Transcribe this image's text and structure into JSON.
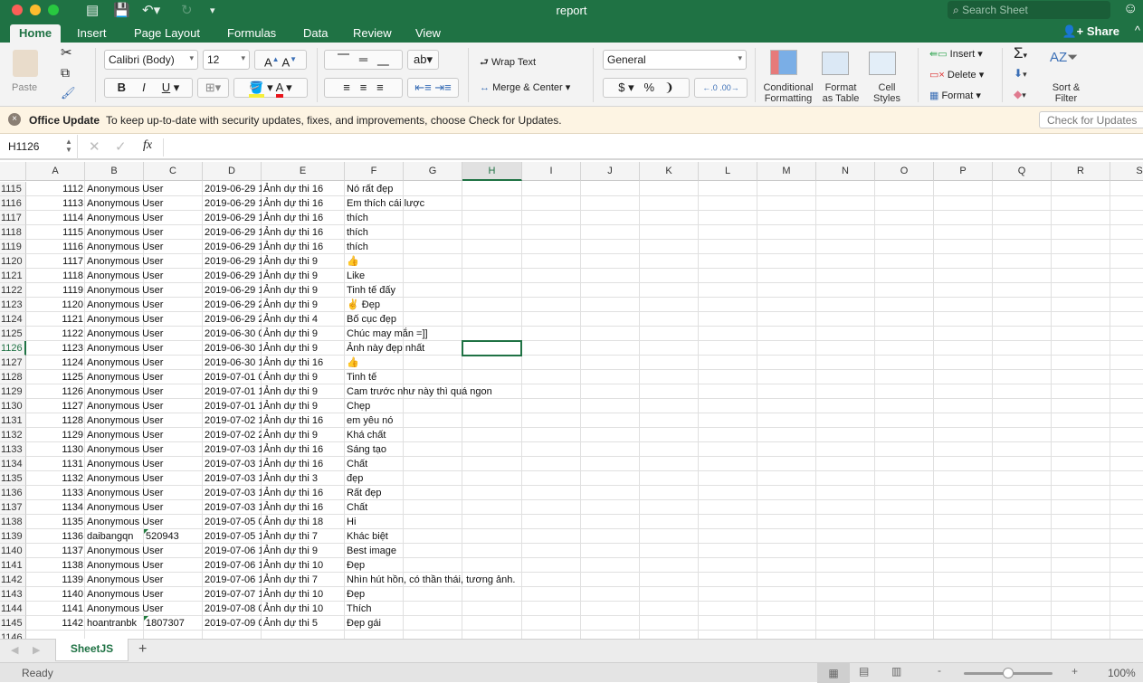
{
  "window": {
    "title": "report",
    "search_placeholder": "Search Sheet",
    "share": "Share"
  },
  "tabs": [
    "Home",
    "Insert",
    "Page Layout",
    "Formulas",
    "Data",
    "Review",
    "View"
  ],
  "ribbon": {
    "paste": "Paste",
    "font_name": "Calibri (Body)",
    "font_size": "12",
    "bold": "B",
    "italic": "I",
    "underline": "U",
    "wrap_text": "Wrap Text",
    "merge_center": "Merge & Center",
    "number_format": "General",
    "currency": "$",
    "percent": "%",
    "comma": "❩",
    "conditional_formatting": [
      "Conditional",
      "Formatting"
    ],
    "format_as_table": [
      "Format",
      "as Table"
    ],
    "cell_styles": [
      "Cell",
      "Styles"
    ],
    "insert": "Insert",
    "delete": "Delete",
    "format": "Format",
    "sort_filter": [
      "Sort &",
      "Filter"
    ],
    "fill_color": "#f5ef3a",
    "font_color": "#e8141b"
  },
  "update_bar": {
    "title": "Office Update",
    "message": "To keep up-to-date with security updates, fixes, and improvements, choose Check for Updates.",
    "button": "Check for Updates"
  },
  "formula_bar": {
    "name_box": "H1126",
    "formula": ""
  },
  "grid": {
    "columns": [
      "A",
      "B",
      "C",
      "D",
      "E",
      "F",
      "G",
      "H",
      "I",
      "J",
      "K",
      "L",
      "M",
      "N",
      "O",
      "P",
      "Q",
      "R",
      "S"
    ],
    "selected_column": "H",
    "selected_row": "1126",
    "rows": [
      [
        "1115",
        "1112",
        "Anonymous User",
        "",
        "2019-06-29 1",
        "Ảnh dự thi 16",
        "Nó rất đẹp"
      ],
      [
        "1116",
        "1113",
        "Anonymous User",
        "",
        "2019-06-29 1",
        "Ảnh dự thi 16",
        "Em thích cái lược"
      ],
      [
        "1117",
        "1114",
        "Anonymous User",
        "",
        "2019-06-29 1",
        "Ảnh dự thi 16",
        "thích"
      ],
      [
        "1118",
        "1115",
        "Anonymous User",
        "",
        "2019-06-29 1",
        "Ảnh dự thi 16",
        "thích"
      ],
      [
        "1119",
        "1116",
        "Anonymous User",
        "",
        "2019-06-29 1",
        "Ảnh dự thi 16",
        "thích"
      ],
      [
        "1120",
        "1117",
        "Anonymous User",
        "",
        "2019-06-29 1",
        "Ảnh dự thi 9",
        "👍"
      ],
      [
        "1121",
        "1118",
        "Anonymous User",
        "",
        "2019-06-29 1",
        "Ảnh dự thi 9",
        "Like"
      ],
      [
        "1122",
        "1119",
        "Anonymous User",
        "",
        "2019-06-29 1",
        "Ảnh dự thi 9",
        "Tinh tế đấy"
      ],
      [
        "1123",
        "1120",
        "Anonymous User",
        "",
        "2019-06-29 2",
        "Ảnh dự thi 9",
        "✌️ Đẹp"
      ],
      [
        "1124",
        "1121",
        "Anonymous User",
        "",
        "2019-06-29 2",
        "Ảnh dự thi 4",
        "Bố cục đẹp"
      ],
      [
        "1125",
        "1122",
        "Anonymous User",
        "",
        "2019-06-30 0",
        "Ảnh dự thi 9",
        "Chúc may mắn =]]"
      ],
      [
        "1126",
        "1123",
        "Anonymous User",
        "",
        "2019-06-30 1",
        "Ảnh dự thi 9",
        "Ảnh này đẹp nhất"
      ],
      [
        "1127",
        "1124",
        "Anonymous User",
        "",
        "2019-06-30 1",
        "Ảnh dự thi 16",
        "👍"
      ],
      [
        "1128",
        "1125",
        "Anonymous User",
        "",
        "2019-07-01 0",
        "Ảnh dự thi 9",
        "Tinh tế"
      ],
      [
        "1129",
        "1126",
        "Anonymous User",
        "",
        "2019-07-01 1",
        "Ảnh dự thi 9",
        "Cam trước như này thì quá ngon"
      ],
      [
        "1130",
        "1127",
        "Anonymous User",
        "",
        "2019-07-01 1",
        "Ảnh dự thi 9",
        "Chẹp"
      ],
      [
        "1131",
        "1128",
        "Anonymous User",
        "",
        "2019-07-02 1",
        "Ảnh dự thi 16",
        "em yêu nó"
      ],
      [
        "1132",
        "1129",
        "Anonymous User",
        "",
        "2019-07-02 2",
        "Ảnh dự thi 9",
        "Khá chất"
      ],
      [
        "1133",
        "1130",
        "Anonymous User",
        "",
        "2019-07-03 1",
        "Ảnh dự thi 16",
        "Sáng tạo"
      ],
      [
        "1134",
        "1131",
        "Anonymous User",
        "",
        "2019-07-03 1",
        "Ảnh dự thi 16",
        "Chất"
      ],
      [
        "1135",
        "1132",
        "Anonymous User",
        "",
        "2019-07-03 1",
        "Ảnh dự thi 3",
        "đẹp"
      ],
      [
        "1136",
        "1133",
        "Anonymous User",
        "",
        "2019-07-03 1",
        "Ảnh dự thi 16",
        "Rất đẹp"
      ],
      [
        "1137",
        "1134",
        "Anonymous User",
        "",
        "2019-07-03 1",
        "Ảnh dự thi 16",
        "Chất"
      ],
      [
        "1138",
        "1135",
        "Anonymous User",
        "",
        "2019-07-05 0",
        "Ảnh dự thi 18",
        "Hi"
      ],
      [
        "1139",
        "1136",
        "daibangqn",
        "520943",
        "2019-07-05 1",
        "Ảnh dự thi 7",
        "Khác biệt"
      ],
      [
        "1140",
        "1137",
        "Anonymous User",
        "",
        "2019-07-06 1",
        "Ảnh dự thi 9",
        "Best image"
      ],
      [
        "1141",
        "1138",
        "Anonymous User",
        "",
        "2019-07-06 1",
        "Ảnh dự thi 10",
        "Đẹp"
      ],
      [
        "1142",
        "1139",
        "Anonymous User",
        "",
        "2019-07-06 1",
        "Ảnh dự thi 7",
        "Nhìn hút hồn, có thần thái, tương ảnh."
      ],
      [
        "1143",
        "1140",
        "Anonymous User",
        "",
        "2019-07-07 1",
        "Ảnh dự thi 10",
        "Đẹp"
      ],
      [
        "1144",
        "1141",
        "Anonymous User",
        "",
        "2019-07-08 0",
        "Ảnh dự thi 10",
        "Thích"
      ],
      [
        "1145",
        "1142",
        "hoantranbk",
        "1807307",
        "2019-07-09 0",
        "Ảnh dự thi 5",
        "Đẹp gái"
      ],
      [
        "1146",
        "",
        "",
        "",
        "",
        "",
        ""
      ]
    ]
  },
  "sheets": {
    "active": "SheetJS",
    "add": "+"
  },
  "status": {
    "text": "Ready",
    "zoom": "100%",
    "zoom_level_percent": 100
  }
}
